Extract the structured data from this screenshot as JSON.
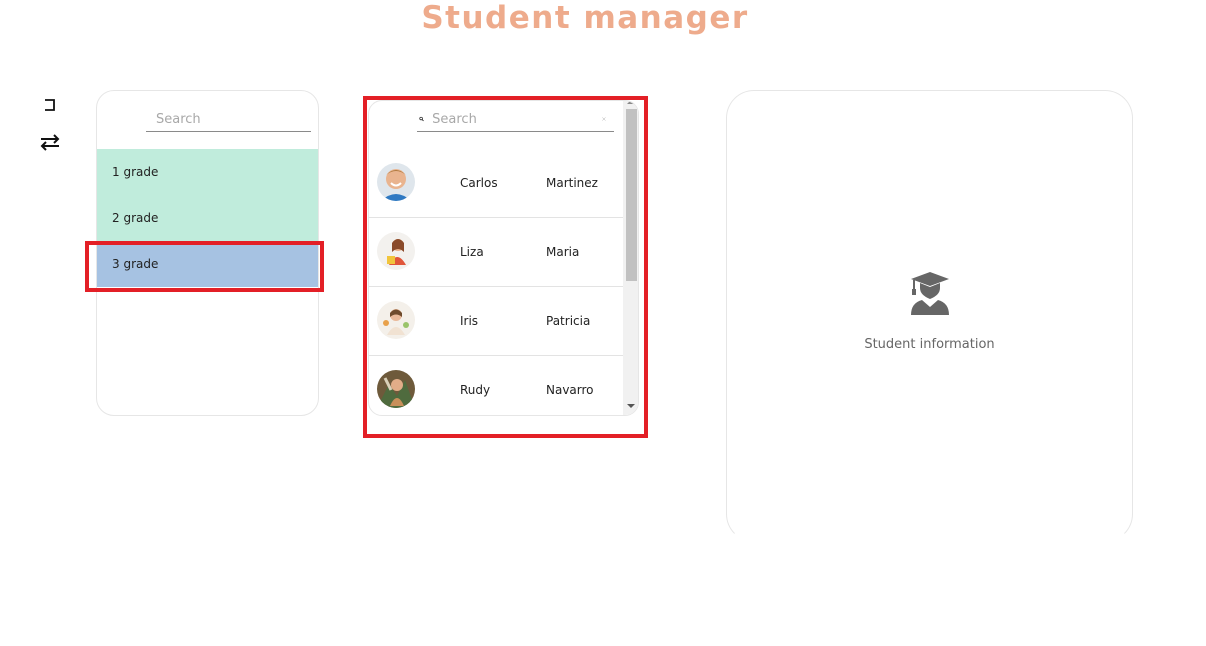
{
  "header": {
    "title": "Student manager",
    "title_color": "#eeab8c"
  },
  "toolbar": {
    "icons": [
      "enter-icon",
      "swap-icon"
    ]
  },
  "grades": {
    "search_placeholder": "Search",
    "items": [
      {
        "label": "1 grade",
        "color": "#c0ecdc"
      },
      {
        "label": "2 grade",
        "color": "#c0ecdc"
      },
      {
        "label": "3 grade",
        "color": "#a6c2e2",
        "selected": true
      }
    ]
  },
  "students": {
    "search_placeholder": "Search",
    "rows": [
      {
        "first": "Carlos",
        "last": "Martinez"
      },
      {
        "first": "Liza",
        "last": "Maria"
      },
      {
        "first": "Iris",
        "last": "Patricia"
      },
      {
        "first": "Rudy",
        "last": "Navarro"
      }
    ]
  },
  "info": {
    "label": "Student information",
    "icon": "student-graduate-icon"
  },
  "highlight_color": "#e31f26"
}
